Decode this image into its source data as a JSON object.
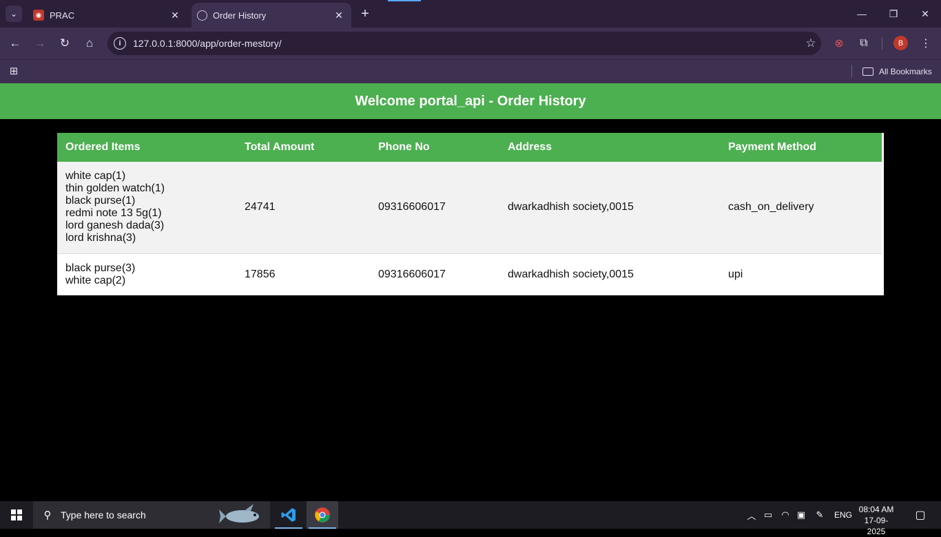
{
  "browser": {
    "tabs": [
      {
        "title": "PRAC",
        "active": false
      },
      {
        "title": "Order History",
        "active": true
      }
    ],
    "url": "127.0.0.1:8000/app/order-mestory/",
    "profile_initial": "B",
    "bookmarks_label": "All Bookmarks"
  },
  "page": {
    "header": "Welcome portal_api - Order History",
    "table": {
      "columns": [
        "Ordered Items",
        "Total Amount",
        "Phone No",
        "Address",
        "Payment Method"
      ],
      "rows": [
        {
          "items": [
            "white cap(1)",
            "thin golden watch(1)",
            "black purse(1)",
            "redmi note 13 5g(1)",
            "lord ganesh dada(3)",
            "lord krishna(3)"
          ],
          "total": "24741",
          "phone": "09316606017",
          "address": "dwarkadhish society,0015",
          "payment": "cash_on_delivery"
        },
        {
          "items": [
            "black purse(3)",
            "white cap(2)"
          ],
          "total": "17856",
          "phone": "09316606017",
          "address": "dwarkadhish society,0015",
          "payment": "upi"
        }
      ]
    }
  },
  "taskbar": {
    "search_placeholder": "Type here to search",
    "language": "ENG",
    "time": "08:04 AM",
    "date": "17-09-2025"
  },
  "colors": {
    "header_green": "#4caf50",
    "tab_bg": "#2b1f3a",
    "toolbar_bg": "#3d3050"
  }
}
